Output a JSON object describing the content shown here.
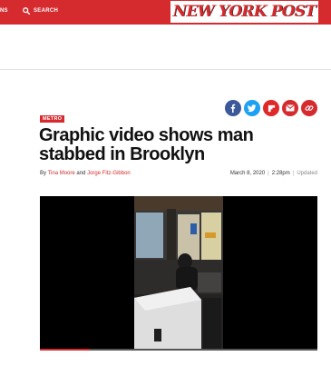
{
  "header": {
    "nav_cut_text": "NS",
    "search_label": "SEARCH",
    "logo_text": "NEW YORK POST",
    "brand_color": "#d52b2f"
  },
  "share_icons": [
    {
      "name": "facebook-icon",
      "color": "#3b5998"
    },
    {
      "name": "twitter-icon",
      "color": "#1da1f2"
    },
    {
      "name": "flipboard-icon",
      "color": "#e12828"
    },
    {
      "name": "email-icon",
      "color": "#d52b2f"
    },
    {
      "name": "link-icon",
      "color": "#d52b2f"
    }
  ],
  "article": {
    "section": "METRO",
    "headline": "Graphic video shows man stabbed in Brooklyn",
    "byline_prefix": "By",
    "author_1": "Tina Moore",
    "byline_and": "and",
    "author_2": "Jorge Fitz-Gibbon",
    "date": "March 8, 2020",
    "time": "2:28pm",
    "updated_label": "Updated"
  },
  "video": {
    "progress_fraction": 0.18
  }
}
